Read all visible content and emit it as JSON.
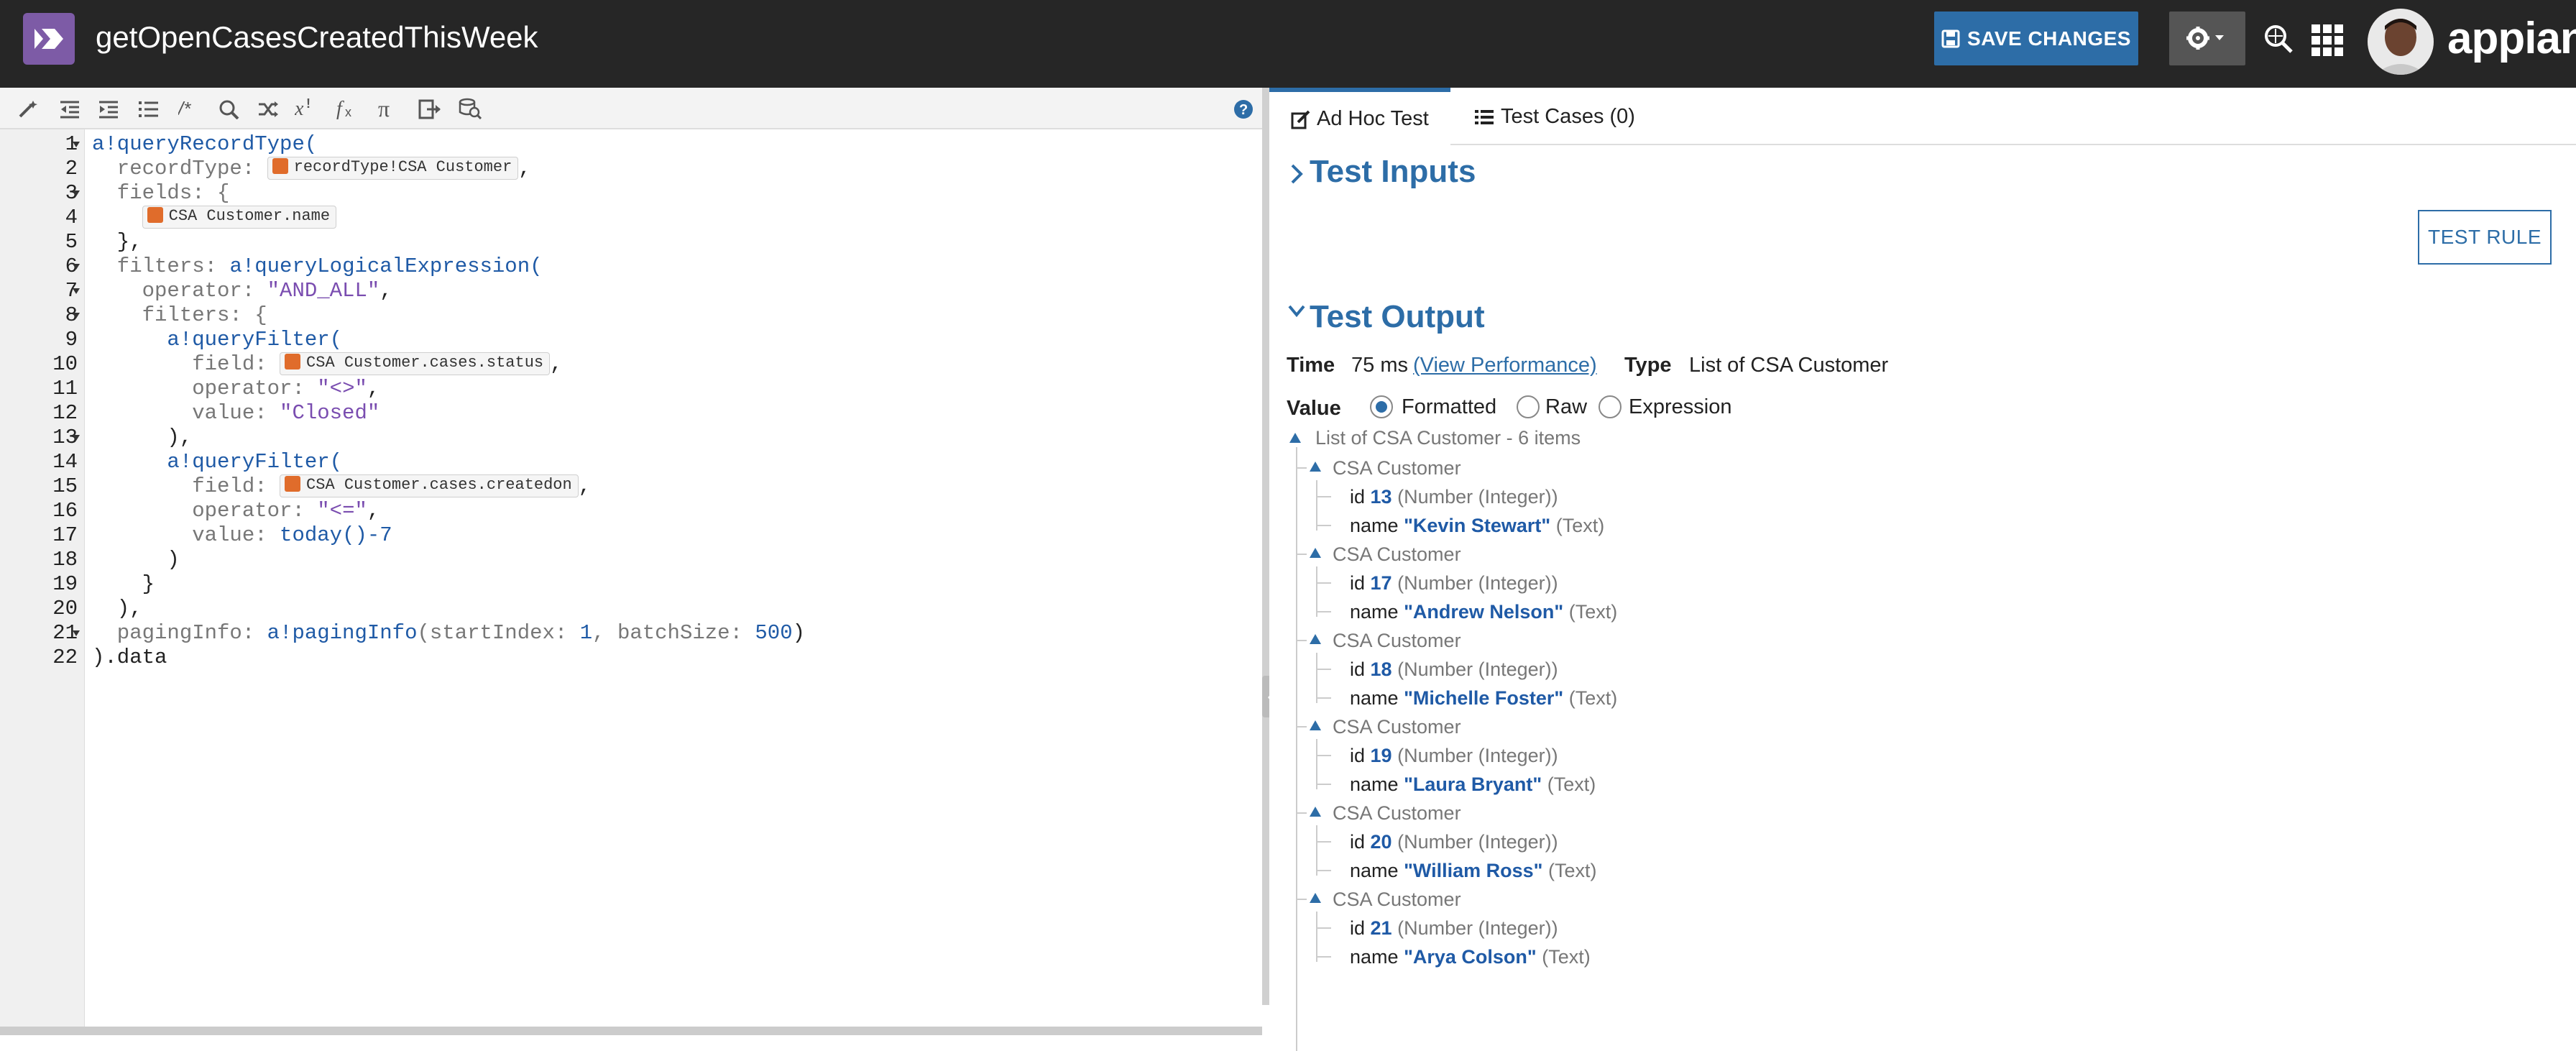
{
  "header": {
    "title": "getOpenCasesCreatedThisWeek",
    "save_label": "SAVE CHANGES",
    "brand": "appian"
  },
  "editor": {
    "line_numbers": [
      "1",
      "2",
      "3",
      "4",
      "5",
      "6",
      "7",
      "8",
      "9",
      "10",
      "11",
      "12",
      "13",
      "14",
      "15",
      "16",
      "17",
      "18",
      "19",
      "20",
      "21",
      "22"
    ],
    "code": {
      "l1_fn": "a!queryRecordType(",
      "l2_key": "  recordType: ",
      "l2_chip": "recordType!CSA Customer",
      "l2_end": ",",
      "l3": "  fields: {",
      "l4_chip": "CSA Customer.name",
      "l5": "  },",
      "l6_key": "  filters: ",
      "l6_fn": "a!queryLogicalExpression(",
      "l7_key": "    operator: ",
      "l7_str": "\"AND_ALL\"",
      "l7_end": ",",
      "l8": "    filters: {",
      "l9_fn": "a!queryFilter(",
      "l10_key": "        field: ",
      "l10_chip": "CSA Customer.cases.status",
      "l10_end": ",",
      "l11_key": "        operator: ",
      "l11_str": "\"<>\"",
      "l11_end": ",",
      "l12_key": "        value: ",
      "l12_str": "\"Closed\"",
      "l13": "      ),",
      "l14_fn": "a!queryFilter(",
      "l15_key": "        field: ",
      "l15_chip": "CSA Customer.cases.createdon",
      "l15_end": ",",
      "l16_key": "        operator: ",
      "l16_str": "\"<=\"",
      "l16_end": ",",
      "l17_key": "        value: ",
      "l17_fn": "today",
      "l17_rest": "()-7",
      "l18": "      )",
      "l19": "    }",
      "l20": "  ),",
      "l21_key": "  pagingInfo: ",
      "l21_fn": "a!pagingInfo",
      "l21_a": "(startIndex: ",
      "l21_n1": "1",
      "l21_b": ", batchSize: ",
      "l21_n2": "500",
      "l21_c": ")",
      "l22": ").data"
    }
  },
  "tabs": {
    "adhoc": "Ad Hoc Test",
    "cases": "Test Cases (0)"
  },
  "test_inputs": {
    "title": "Test Inputs",
    "button": "TEST RULE"
  },
  "test_output": {
    "title": "Test Output",
    "time_label": "Time",
    "time_value": "75 ms",
    "perf_link": "(View Performance)",
    "type_label": "Type",
    "type_value": "List of CSA Customer",
    "value_label": "Value",
    "modes": [
      "Formatted",
      "Raw",
      "Expression"
    ],
    "list_title": "List of CSA Customer - 6 items",
    "item_type": "CSA Customer",
    "id_label": "id",
    "id_type": "(Number (Integer))",
    "name_label": "name",
    "name_type": "(Text)",
    "items": [
      {
        "id": "13",
        "name": "\"Kevin Stewart\""
      },
      {
        "id": "17",
        "name": "\"Andrew Nelson\""
      },
      {
        "id": "18",
        "name": "\"Michelle Foster\""
      },
      {
        "id": "19",
        "name": "\"Laura Bryant\""
      },
      {
        "id": "20",
        "name": "\"William Ross\""
      },
      {
        "id": "21",
        "name": "\"Arya Colson\""
      }
    ]
  },
  "colors": {
    "accent": "#2d6da7",
    "topbar": "#262626",
    "app_icon": "#7d5ba6"
  }
}
